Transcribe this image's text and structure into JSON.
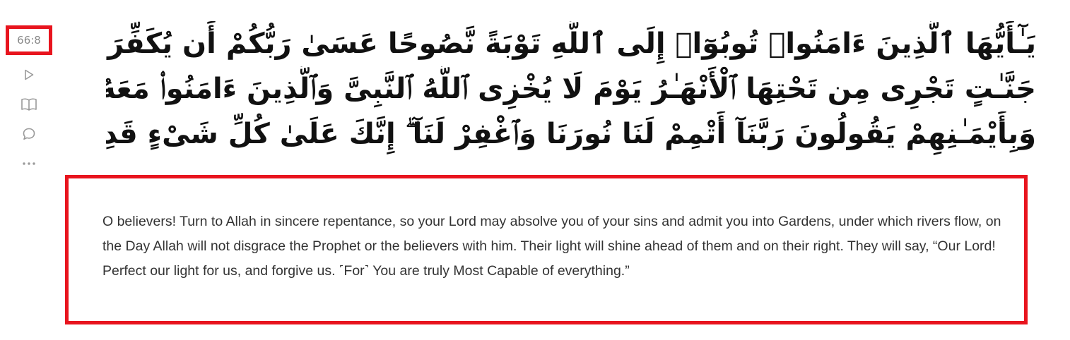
{
  "verse": {
    "key": "66:8",
    "number": "٨",
    "arabic_lines": [
      "يَـٰٓأَيُّهَا ٱلَّذِينَ ءَامَنُوا۟ تُوبُوٓا۟ إِلَى ٱللَّهِ تَوْبَةً نَّصُوحًا عَسَىٰ رَبُّكُمْ أَن يُكَفِّرَ عَنكُمْ سَيِّـَٔاتِكُمْ وَيُدْخِلَكُمْ",
      "جَنَّـٰتٍ تَجْرِى مِن تَحْتِهَا ٱلْأَنْهَـٰرُ يَوْمَ لَا يُخْزِى ٱللَّهُ ٱلنَّبِىَّ وَٱلَّذِينَ ءَامَنُوا۟ مَعَهُۥ ۖ نُورُهُمْ يَسْعَىٰ بَيْنَ أَيْدِيهِمْ",
      "وَبِأَيْمَـٰنِهِمْ يَقُولُونَ رَبَّنَآ أَتْمِمْ لَنَا نُورَنَا وَٱغْفِرْ لَنَآ ۖ إِنَّكَ عَلَىٰ كُلِّ شَىْءٍ قَدِيرٌ"
    ],
    "translation": "O believers! Turn to Allah in sincere repentance, so your Lord may absolve you of your sins and admit you into Gardens, under which rivers flow, on the Day Allah will not disgrace the Prophet or the believers with him. Their light will shine ahead of them and on their right. They will say, “Our Lord! Perfect our light for us, and forgive us. ˹For˺ You are truly Most Capable of everything.”"
  },
  "actions": [
    {
      "name": "play-icon"
    },
    {
      "name": "book-icon"
    },
    {
      "name": "comment-icon"
    },
    {
      "name": "more-icon"
    }
  ],
  "colors": {
    "highlight": "#e8141e",
    "icon": "#9a9a9a",
    "text": "#333333"
  }
}
